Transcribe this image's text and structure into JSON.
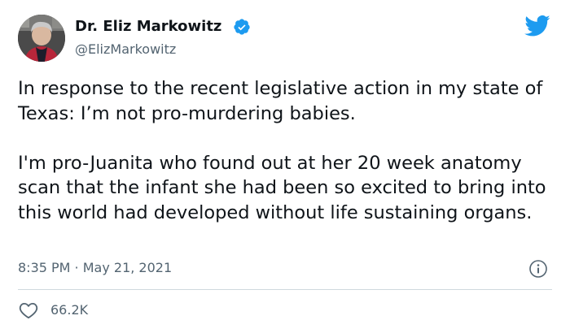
{
  "author": {
    "display_name": "Dr. Eliz Markowitz",
    "handle": "@ElizMarkowitz",
    "verified": true,
    "avatar_icon": "profile-photo"
  },
  "tweet": {
    "paragraphs": [
      "In response to the recent legislative action in my state of Texas: I’m not pro-murdering babies.",
      "I'm pro-Juanita who found out at her 20 week anatomy scan that the infant she had been so excited to bring into this world had developed without life sustaining organs."
    ],
    "timestamp": "8:35 PM · May 21, 2021"
  },
  "engagement": {
    "likes": "66.2K",
    "like_icon": "heart-icon"
  },
  "icons": {
    "brand": "twitter-bird-icon",
    "info": "info-icon",
    "verified": "verified-badge-icon"
  },
  "colors": {
    "brand_blue": "#1d9bf0",
    "text_primary": "#0f1419",
    "text_secondary": "#536471",
    "divider": "#cfd9de"
  }
}
